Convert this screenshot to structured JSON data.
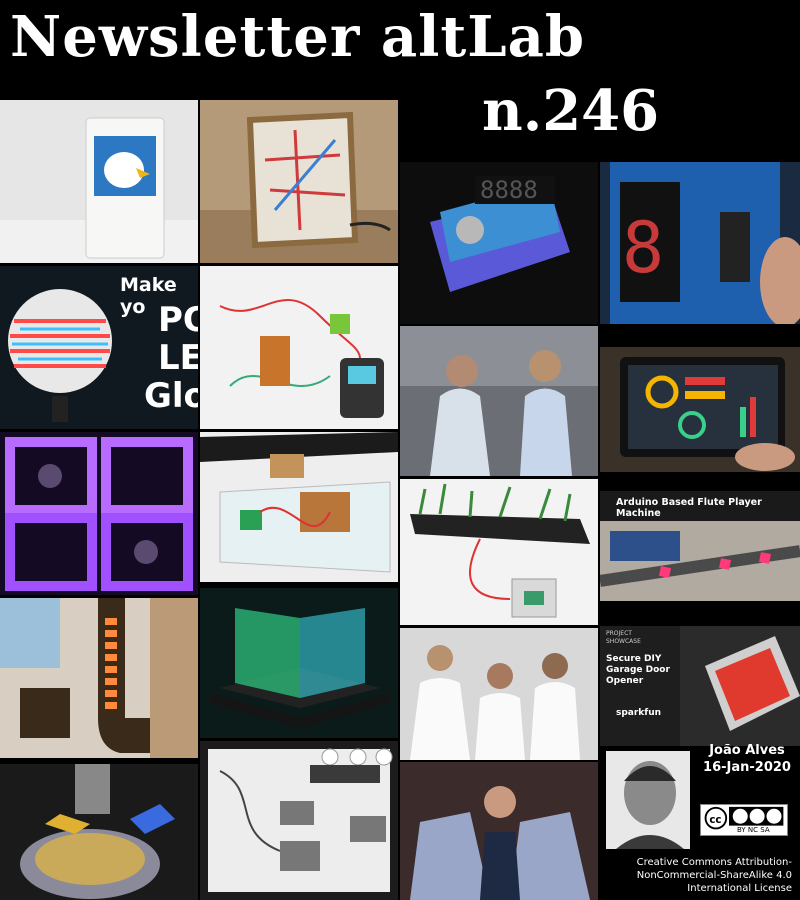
{
  "header": {
    "title": "Newsletter altLab",
    "issue": "n.246"
  },
  "tiles": {
    "pov_text": [
      "Make yo",
      "PO",
      "LE",
      "Glo"
    ],
    "flute_text": "Arduino Based Flute Player Machine",
    "garage": {
      "kicker": "PROJECT SHOWCASE",
      "title": "Secure DIY Garage Door Opener",
      "brand": "sparkfun"
    }
  },
  "credits": {
    "author": "João Alves",
    "date": "16-Jan-2020",
    "license": "Creative Commons Attribution-NonCommercial-ShareAlike 4.0 International License",
    "badge": "BY NC SA"
  },
  "colors": {
    "background": "#000000",
    "text": "#ffffff",
    "sparkfun_red": "#e03a2f",
    "grow_purple": "#8a3cff",
    "cube_green": "#37d98a"
  }
}
